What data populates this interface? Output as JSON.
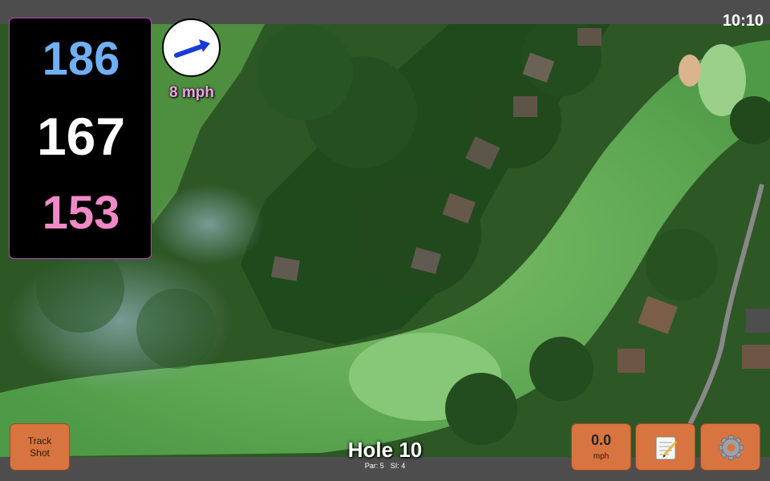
{
  "status_bar": {
    "clock": "10:10"
  },
  "yardages": {
    "back": "186",
    "center": "167",
    "front": "153"
  },
  "wind": {
    "speed_label": "8 mph",
    "icon": "arrow-right-up-icon"
  },
  "hole": {
    "title": "Hole 10",
    "par_label": "Par: 5",
    "si_label": "SI: 4"
  },
  "buttons": {
    "track_shot_line1": "Track",
    "track_shot_line2": "Shot",
    "speed_value": "0.0",
    "speed_unit": "mph",
    "notes_icon": "notepad-icon",
    "settings_icon": "gear-icon"
  },
  "colors": {
    "back_yardage": "#6fb0f5",
    "center_yardage": "#ffffff",
    "front_yardage": "#f089c8",
    "wind_label": "#f0a0e8",
    "button_orange": "#d8743f"
  }
}
